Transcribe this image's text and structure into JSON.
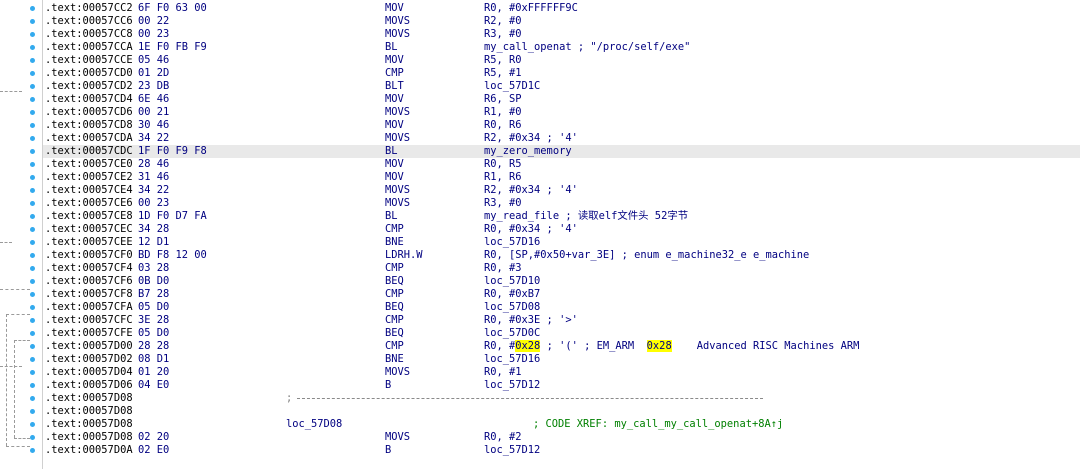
{
  "colors": {
    "address": "#000000",
    "code": "#000080",
    "comment": "#008000",
    "highlight": "#ffff00",
    "selected_row": "#e9e9e9",
    "dot": "#33aaee"
  },
  "rows": [
    {
      "addr": ".text:00057CC2",
      "bytes": "6F F0 63 00",
      "mnem": "MOV",
      "ops": "R0, #0xFFFFFF9C"
    },
    {
      "addr": ".text:00057CC6",
      "bytes": "00 22",
      "mnem": "MOVS",
      "ops": "R2, #0"
    },
    {
      "addr": ".text:00057CC8",
      "bytes": "00 23",
      "mnem": "MOVS",
      "ops": "R3, #0"
    },
    {
      "addr": ".text:00057CCA",
      "bytes": "1E F0 FB F9",
      "mnem": "BL",
      "ops": "my_call_openat ; \"/proc/self/exe\""
    },
    {
      "addr": ".text:00057CCE",
      "bytes": "05 46",
      "mnem": "MOV",
      "ops": "R5, R0"
    },
    {
      "addr": ".text:00057CD0",
      "bytes": "01 2D",
      "mnem": "CMP",
      "ops": "R5, #1"
    },
    {
      "addr": ".text:00057CD2",
      "bytes": "23 DB",
      "mnem": "BLT",
      "ops": "loc_57D1C"
    },
    {
      "addr": ".text:00057CD4",
      "bytes": "6E 46",
      "mnem": "MOV",
      "ops": "R6, SP"
    },
    {
      "addr": ".text:00057CD6",
      "bytes": "00 21",
      "mnem": "MOVS",
      "ops": "R1, #0"
    },
    {
      "addr": ".text:00057CD8",
      "bytes": "30 46",
      "mnem": "MOV",
      "ops": "R0, R6"
    },
    {
      "addr": ".text:00057CDA",
      "bytes": "34 22",
      "mnem": "MOVS",
      "ops": "R2, #0x34 ; '4'"
    },
    {
      "addr": ".text:00057CDC",
      "bytes": "1F F0 F9 F8",
      "mnem": "BL",
      "ops": "my_zero_memory"
    },
    {
      "addr": ".text:00057CE0",
      "bytes": "28 46",
      "mnem": "MOV",
      "ops": "R0, R5"
    },
    {
      "addr": ".text:00057CE2",
      "bytes": "31 46",
      "mnem": "MOV",
      "ops": "R1, R6"
    },
    {
      "addr": ".text:00057CE4",
      "bytes": "34 22",
      "mnem": "MOVS",
      "ops": "R2, #0x34 ; '4'"
    },
    {
      "addr": ".text:00057CE6",
      "bytes": "00 23",
      "mnem": "MOVS",
      "ops": "R3, #0"
    },
    {
      "addr": ".text:00057CE8",
      "bytes": "1D F0 D7 FA",
      "mnem": "BL",
      "ops": "my_read_file ; 读取elf文件头 52字节"
    },
    {
      "addr": ".text:00057CEC",
      "bytes": "34 28",
      "mnem": "CMP",
      "ops": "R0, #0x34 ; '4'"
    },
    {
      "addr": ".text:00057CEE",
      "bytes": "12 D1",
      "mnem": "BNE",
      "ops": "loc_57D16"
    },
    {
      "addr": ".text:00057CF0",
      "bytes": "BD F8 12 00",
      "mnem": "LDRH.W",
      "ops": "R0, [SP,#0x50+var_3E] ; enum e_machine32_e e_machine"
    },
    {
      "addr": ".text:00057CF4",
      "bytes": "03 28",
      "mnem": "CMP",
      "ops": "R0, #3"
    },
    {
      "addr": ".text:00057CF6",
      "bytes": "0B D0",
      "mnem": "BEQ",
      "ops": "loc_57D10"
    },
    {
      "addr": ".text:00057CF8",
      "bytes": "B7 28",
      "mnem": "CMP",
      "ops": "R0, #0xB7"
    },
    {
      "addr": ".text:00057CFA",
      "bytes": "05 D0",
      "mnem": "BEQ",
      "ops": "loc_57D08"
    },
    {
      "addr": ".text:00057CFC",
      "bytes": "3E 28",
      "mnem": "CMP",
      "ops": "R0, #0x3E ; '>'"
    },
    {
      "addr": ".text:00057CFE",
      "bytes": "05 D0",
      "mnem": "BEQ",
      "ops": "loc_57D0C"
    },
    {
      "addr": ".text:00057D00",
      "bytes": "28 28",
      "mnem": "CMP",
      "ops_pre": "R0, #",
      "ops_hl": "0x28",
      "ops_mid": " ; '(' ; EM_ARM  ",
      "ops_hl2": "0x28",
      "ops_post": "    Advanced RISC Machines ARM"
    },
    {
      "addr": ".text:00057D02",
      "bytes": "08 D1",
      "mnem": "BNE",
      "ops": "loc_57D16"
    },
    {
      "addr": ".text:00057D04",
      "bytes": "01 20",
      "mnem": "MOVS",
      "ops": "R0, #1"
    },
    {
      "addr": ".text:00057D06",
      "bytes": "04 E0",
      "mnem": "B",
      "ops": "loc_57D12"
    },
    {
      "addr": ".text:00057D08",
      "sep": ";"
    },
    {
      "addr": ".text:00057D08"
    },
    {
      "addr": ".text:00057D08",
      "label": "loc_57D08",
      "xref": "; CODE XREF: my_call_my_call_openat+8A↑j"
    },
    {
      "addr": ".text:00057D08",
      "bytes": "02 20",
      "mnem": "MOVS",
      "ops": "R0, #2"
    },
    {
      "addr": ".text:00057D0A",
      "bytes": "02 E0",
      "mnem": "B",
      "ops": "loc_57D12"
    }
  ]
}
